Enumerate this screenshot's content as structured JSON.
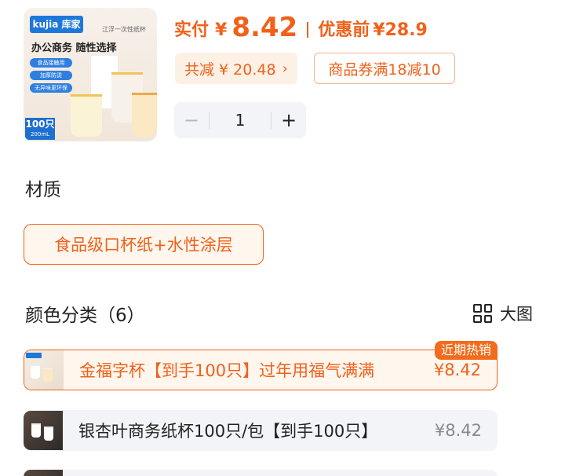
{
  "product_image": {
    "brand": "kujia 库家",
    "tagline": "江浮一次性纸杯",
    "headline": "办公商务  随性选择",
    "features": [
      "食品接触用",
      "加厚防烫",
      "无异味更环保"
    ],
    "count": "100只",
    "volume": "200mL"
  },
  "price": {
    "actual_label": "实付",
    "currency": "¥",
    "actual_value": "8.42",
    "original_label": "优惠前",
    "original_value": "¥28.9"
  },
  "discount": {
    "total_label": "共减 ¥ 20.48",
    "chevron": "›",
    "coupon": "商品券满18减10"
  },
  "quantity": {
    "minus": "−",
    "value": "1",
    "plus": "+"
  },
  "material": {
    "title": "材质",
    "selected": "食品级口杯纸+水性涂层"
  },
  "color": {
    "title": "颜色分类（6）",
    "big_view_label": "大图",
    "options": [
      {
        "name": "金福字杯【到手100只】过年用福气满满",
        "price": "¥8.42",
        "badge": "近期热销"
      },
      {
        "name": "银杏叶商务纸杯100只/包【到手100只】",
        "price": "¥8.42"
      }
    ]
  },
  "colors": {
    "accent": "#f0611a",
    "accent_bg": "#fff6ee",
    "neutral_bg": "#f2f4f7"
  }
}
